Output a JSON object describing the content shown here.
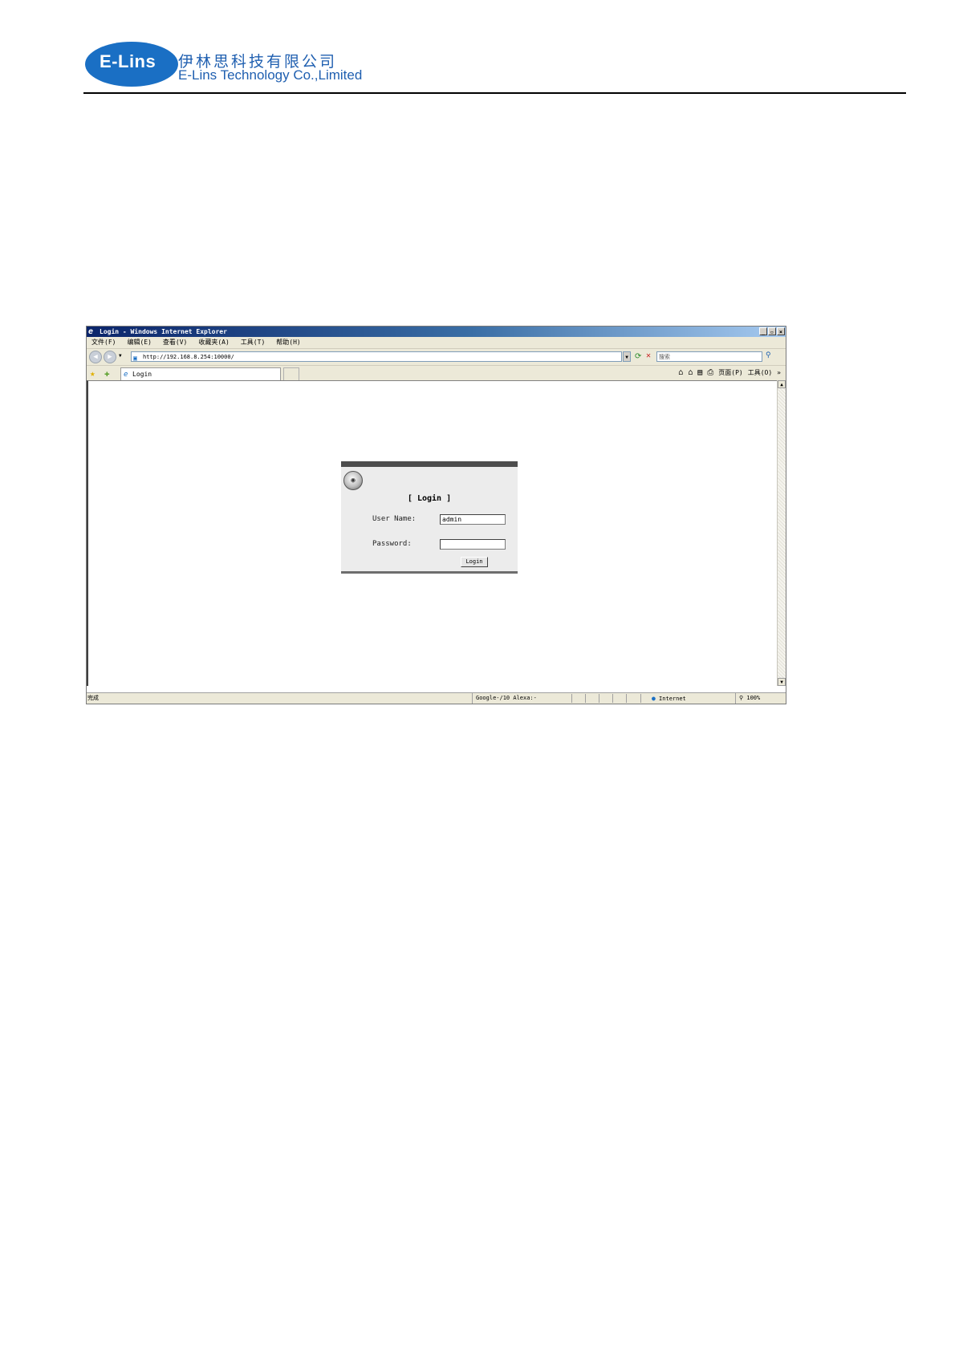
{
  "document": {
    "logo_text": "E-Lins",
    "company_name_cn": "伊林思科技有限公司",
    "company_name_en": "E-Lins Technology Co.,Limited"
  },
  "browser": {
    "window_title": "Login - Windows Internet Explorer",
    "window_buttons": [
      "_",
      "▫",
      "×"
    ],
    "menu": [
      "文件(F)",
      "编辑(E)",
      "查看(V)",
      "收藏夹(A)",
      "工具(T)",
      "帮助(H)"
    ],
    "address": "http://192.168.8.254:10000/",
    "search_placeholder": "搜索",
    "tab_title": "Login",
    "command_bar": {
      "page": "页面(P)",
      "tools": "工具(O)",
      "more": "»"
    },
    "status": {
      "left": "完成",
      "google": "Google-/10  Alexa:-",
      "zone": "Internet",
      "zoom": "100%"
    }
  },
  "login": {
    "title": "[ Login ]",
    "user_label": "User Name:",
    "user_value": "admin",
    "password_label": "Password:",
    "password_value": "",
    "button": "Login"
  }
}
